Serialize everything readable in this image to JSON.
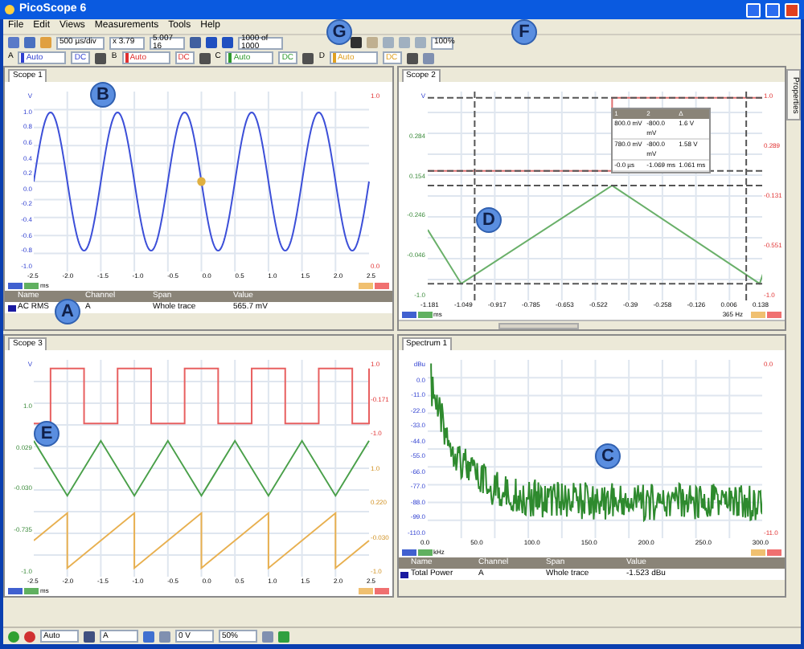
{
  "window": {
    "title": "PicoScope 6"
  },
  "menu": [
    "File",
    "Edit",
    "Views",
    "Measurements",
    "Tools",
    "Help"
  ],
  "toolbar": {
    "timebase": "500 µs/div",
    "zoom": "x 3.79",
    "samples": "5.007 16",
    "buffer": "1000 of 1000",
    "view_zoom": "100%"
  },
  "channels": [
    {
      "letter": "A",
      "range": "Auto",
      "coupling": "DC",
      "color": "#2f3fd0"
    },
    {
      "letter": "B",
      "range": "Auto",
      "coupling": "DC",
      "color": "#e03030"
    },
    {
      "letter": "C",
      "range": "Auto",
      "coupling": "DC",
      "color": "#2e9a2e"
    },
    {
      "letter": "D",
      "range": "Auto",
      "coupling": "DC",
      "color": "#e0a020"
    }
  ],
  "panels": [
    {
      "tab": "Scope 1",
      "y_unit": "V",
      "y_labels": [
        "1.0",
        "0.8",
        "0.6",
        "0.4",
        "0.2",
        "0.0",
        "-0.2",
        "-0.4",
        "-0.6",
        "-0.8",
        "-1.0"
      ],
      "right_labels": [
        "1.0",
        "0.0"
      ],
      "x_labels": [
        "-2.5",
        "-2.0",
        "-1.5",
        "-1.0",
        "-0.5",
        "0.0",
        "0.5",
        "1.0",
        "1.5",
        "2.0",
        "2.5"
      ],
      "x_unit": "ms",
      "traces": [
        {
          "kind": "sine",
          "color": "#3c4fd8"
        }
      ],
      "table": {
        "columns": [
          "Name",
          "Channel",
          "Span",
          "Value"
        ],
        "rows": [
          [
            "AC RMS",
            "A",
            "Whole trace",
            "565.7 mV"
          ]
        ]
      }
    },
    {
      "tab": "Scope 2",
      "y_unit": "V",
      "y_labels": [
        "0.284",
        "0.154",
        "-0.246",
        "-0.046",
        "-1.0"
      ],
      "right_labels": [
        "1.0",
        "0.289",
        "-0.131",
        "-0.551",
        "-1.0"
      ],
      "x_labels": [
        "-1.181",
        "-1.049",
        "-0.917",
        "-0.785",
        "-0.653",
        "-0.522",
        "-0.39",
        "-0.258",
        "-0.126",
        "0.006",
        "0.138"
      ],
      "x_unit": "ms",
      "footer": "365 Hz",
      "traces": [
        {
          "kind": "step",
          "color": "#e07070"
        },
        {
          "kind": "slow-triangle",
          "color": "#6ab06a"
        }
      ],
      "cursor_table": {
        "columns": [
          "1",
          "2",
          "Δ"
        ],
        "rows": [
          [
            "800.0 mV",
            "-800.0 mV",
            "1.6 V"
          ],
          [
            "780.0 mV",
            "-800.0 mV",
            "1.58 V"
          ],
          [
            "-0.0 µs",
            "-1.069 ms",
            "1.061 ms"
          ]
        ]
      }
    },
    {
      "tab": "Scope 3",
      "y_unit": "V",
      "y_labels": [
        "1.0",
        "0.029",
        "-0.030",
        "-0.735",
        "-1.0"
      ],
      "right_labels": [
        "1.0",
        "-0.171",
        "-1.0",
        "1.0",
        "0.220",
        "-0.030",
        "-1.0"
      ],
      "x_labels": [
        "-2.5",
        "-2.0",
        "-1.5",
        "-1.0",
        "-0.5",
        "0.0",
        "0.5",
        "1.0",
        "1.5",
        "2.0",
        "2.5"
      ],
      "x_unit": "ms",
      "traces": [
        {
          "kind": "square",
          "color": "#e86060"
        },
        {
          "kind": "triangle",
          "color": "#4aa04a"
        },
        {
          "kind": "sawtooth",
          "color": "#e8b050"
        }
      ]
    },
    {
      "tab": "Spectrum 1",
      "y_unit": "dBu",
      "y_labels": [
        "0.0",
        "-11.0",
        "-22.0",
        "-33.0",
        "-44.0",
        "-55.0",
        "-66.0",
        "-77.0",
        "-88.0",
        "-99.0",
        "-110.0"
      ],
      "right_labels": [
        "0.0",
        "-11.0"
      ],
      "x_labels": [
        "0.0",
        "50.0",
        "100.0",
        "150.0",
        "200.0",
        "250.0",
        "300.0"
      ],
      "x_unit": "kHz",
      "traces": [
        {
          "kind": "spectrum",
          "color": "#2e8a2e"
        }
      ],
      "table": {
        "columns": [
          "Name",
          "Channel",
          "Span",
          "Value"
        ],
        "rows": [
          [
            "Total Power",
            "A",
            "Whole trace",
            "-1.523 dBu"
          ]
        ]
      }
    }
  ],
  "side_tab": "Properties",
  "status_bar": {
    "trigger_mode": "Auto",
    "trigger_channel": "A",
    "threshold": "0 V",
    "pre_trigger": "50%"
  },
  "callouts": [
    "G",
    "F",
    "B",
    "A",
    "D",
    "E",
    "C"
  ]
}
